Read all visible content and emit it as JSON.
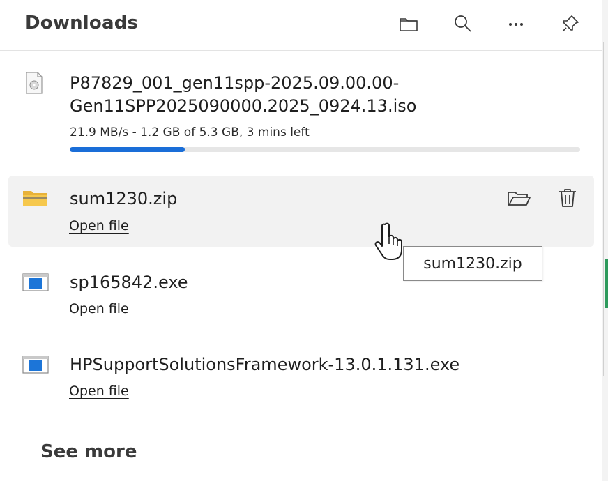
{
  "header": {
    "title": "Downloads",
    "buttons": [
      {
        "name": "open-downloads-folder",
        "icon": "folder-icon"
      },
      {
        "name": "search-downloads",
        "icon": "search-icon"
      },
      {
        "name": "more-options",
        "icon": "more-icon"
      },
      {
        "name": "pin-downloads",
        "icon": "pin-icon"
      }
    ]
  },
  "downloads": [
    {
      "name_line1": "P87829_001_gen11spp-2025.09.00.00-",
      "name_line2": "Gen11SPP2025090000.2025_0924.13.iso",
      "status": "21.9 MB/s - 1.2 GB of 5.3 GB, 3 mins left",
      "progress_fraction": 0.226,
      "icon": "disc-image-file-icon"
    },
    {
      "name": "sum1230.zip",
      "action": "Open file",
      "icon": "zip-folder-icon",
      "hovered": true
    },
    {
      "name": "sp165842.exe",
      "action": "Open file",
      "icon": "exe-window-icon"
    },
    {
      "name": "HPSupportSolutionsFramework-13.0.1.131.exe",
      "action": "Open file",
      "icon": "exe-window-icon"
    }
  ],
  "tooltip": "sum1230.zip",
  "footer": {
    "see_more": "See more"
  },
  "colors": {
    "progress": "#1a6ed8",
    "hover_row": "#f2f2f2",
    "accent_green": "#2e9a5c"
  }
}
